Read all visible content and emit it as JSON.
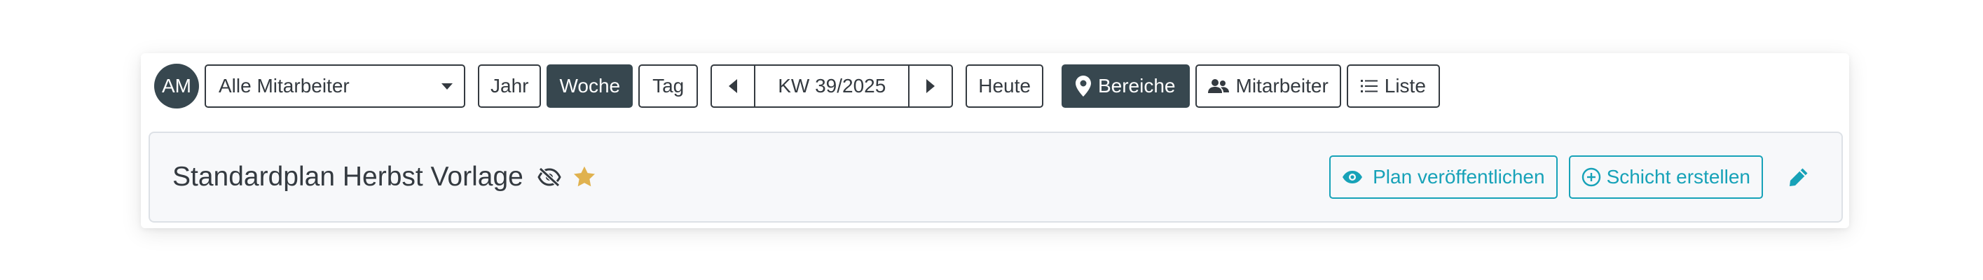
{
  "avatar": {
    "initials": "AM"
  },
  "employee_select": {
    "value": "Alle Mitarbeiter"
  },
  "view_modes": {
    "year": "Jahr",
    "week": "Woche",
    "day": "Tag",
    "active": "Woche"
  },
  "week_nav": {
    "label": "KW 39/2025"
  },
  "today_label": "Heute",
  "grouping": {
    "areas": "Bereiche",
    "employees": "Mitarbeiter",
    "list": "Liste",
    "active": "Bereiche"
  },
  "plan": {
    "title": "Standardplan Herbst Vorlage",
    "publish_label": "Plan veröffentlichen",
    "create_shift_label": "Schicht erstellen"
  },
  "colors": {
    "dark": "#37474f",
    "accent": "#17a2b8",
    "star": "#e0b24f"
  },
  "icons": [
    "chevron-down-icon",
    "caret-left-icon",
    "caret-right-icon",
    "map-marker-icon",
    "users-icon",
    "list-icon",
    "eye-slash-icon",
    "star-icon",
    "eye-icon",
    "plus-circle-icon",
    "pencil-icon"
  ]
}
